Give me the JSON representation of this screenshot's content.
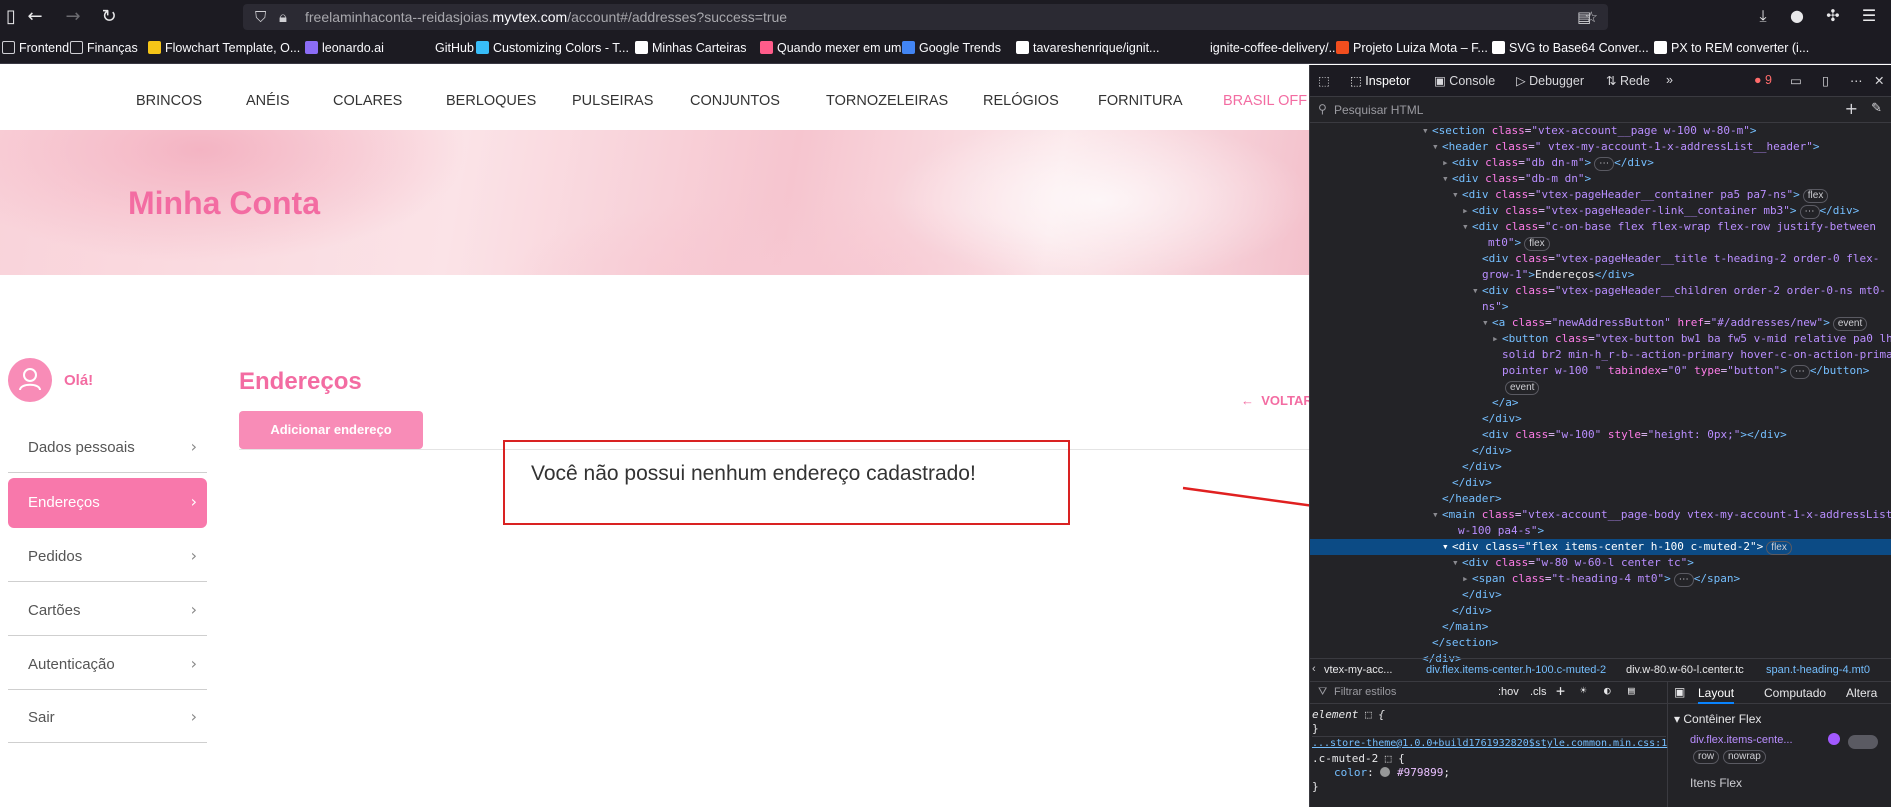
{
  "browser": {
    "url_prefix": "freelaminhaconta--reidasjoias.",
    "url_domain": "myvtex.com",
    "url_path": "/account#/addresses?success=true",
    "bookmarks": [
      {
        "label": "Frontend",
        "icon": "folder-icon",
        "color": "#cfcfd4"
      },
      {
        "label": "Finanças",
        "icon": "folder-icon",
        "color": "#cfcfd4"
      },
      {
        "label": "Flowchart Template, O...",
        "icon": "miro-icon",
        "color": "#f5c518"
      },
      {
        "label": "leonardo.ai",
        "icon": "leonardo-icon",
        "color": "#8b6cf5"
      },
      {
        "label": "GitHub",
        "icon": "github-icon",
        "color": "#1c1b22"
      },
      {
        "label": "Customizing Colors - T...",
        "icon": "tailwind-icon",
        "color": "#38bdf8"
      },
      {
        "label": "Minhas Carteiras",
        "icon": "chart-icon",
        "color": "#ffffff"
      },
      {
        "label": "Quando mexer em um...",
        "icon": "app-icon",
        "color": "#ff5c8a"
      },
      {
        "label": "Google Trends",
        "icon": "trends-icon",
        "color": "#4285f4"
      },
      {
        "label": "tavareshenrique/ignit...",
        "icon": "github-icon",
        "color": "#ffffff"
      },
      {
        "label": "ignite-coffee-delivery/...",
        "icon": "github-icon",
        "color": "#1c1b22"
      },
      {
        "label": "Projeto Luiza Mota – F...",
        "icon": "figma-icon",
        "color": "#f24e1e"
      },
      {
        "label": "SVG to Base64 Conver...",
        "icon": "svg-icon",
        "color": "#ffffff"
      },
      {
        "label": "PX to REM converter (i...",
        "icon": "px-icon",
        "color": "#ffffff"
      }
    ]
  },
  "store": {
    "nav": [
      "BRINCOS",
      "ANÉIS",
      "COLARES",
      "BERLOQUES",
      "PULSEIRAS",
      "CONJUNTOS",
      "TORNOZELEIRAS",
      "RELÓGIOS",
      "FORNITURA",
      "BRASIL OFF"
    ],
    "banner_title": "Minha Conta",
    "greeting": "Olá!",
    "sidebar": [
      {
        "label": "Dados pessoais",
        "active": false
      },
      {
        "label": "Endereços",
        "active": true
      },
      {
        "label": "Pedidos",
        "active": false
      },
      {
        "label": "Cartões",
        "active": false
      },
      {
        "label": "Autenticação",
        "active": false
      },
      {
        "label": "Sair",
        "active": false
      }
    ],
    "page_title": "Endereços",
    "add_button": "Adicionar endereço",
    "back_link": "VOLTAR",
    "empty_message": "Você não possui nenhum endereço cadastrado!",
    "accent_color": "#f36ca2"
  },
  "devtools": {
    "tabs": [
      "Inspetor",
      "Console",
      "Debugger",
      "Rede"
    ],
    "error_count": "9",
    "search_placeholder": "Pesquisar HTML",
    "breadcrumbs": [
      "vtex-my-acc...",
      "div.flex.items-center.h-100.c-muted-2",
      "div.w-80.w-60-l.center.tc",
      "span.t-heading-4.mt0"
    ],
    "styles_filter": "Filtrar estilos",
    "styles_toggles": [
      ":hov",
      ".cls"
    ],
    "rule_element": "element",
    "rule_source": "...store-theme@1.0.0+build1761932820$style.common.min.css:1",
    "rule_selector": ".c-muted-2",
    "rule_prop": "color",
    "rule_value": "#979899",
    "layout_tabs": [
      "Layout",
      "Computado",
      "Altera"
    ],
    "flex_container": "Contêiner Flex",
    "flex_item_name": "div.flex.items-cente...",
    "flex_tags": [
      "row",
      "nowrap"
    ],
    "flex_items": "Itens Flex"
  }
}
